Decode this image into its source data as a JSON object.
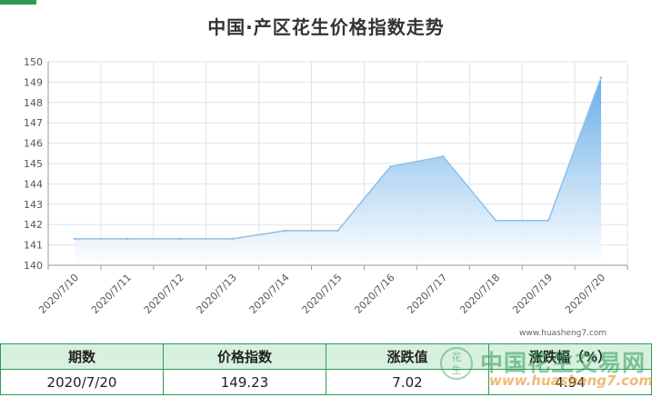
{
  "title": "中国·产区花生价格指数走势",
  "colors": {
    "line": "#8fbfe8",
    "area_top": "#5fa8e8",
    "area_bottom": "#ffffff",
    "grid": "#dde3ea",
    "axis": "#999999",
    "table_border": "#2e9b55",
    "table_header_bg": "#d7f0df"
  },
  "chart_data": {
    "type": "area",
    "title": "中国·产区花生价格指数走势",
    "xlabel": "",
    "ylabel": "",
    "categories": [
      "2020/7/10",
      "2020/7/11",
      "2020/7/12",
      "2020/7/13",
      "2020/7/14",
      "2020/7/15",
      "2020/7/16",
      "2020/7/17",
      "2020/7/18",
      "2020/7/19",
      "2020/7/20"
    ],
    "series": [
      {
        "values": [
          141.3,
          141.3,
          141.3,
          141.3,
          141.7,
          141.7,
          144.85,
          145.35,
          142.2,
          142.2,
          149.23
        ]
      }
    ],
    "ylim": [
      140,
      150
    ],
    "yticks": [
      140,
      141,
      142,
      143,
      144,
      145,
      146,
      147,
      148,
      149,
      150
    ],
    "grid": true,
    "legend": "none"
  },
  "watermark": {
    "url": "www.huasheng7.com",
    "brand_cn": "中国花生交易网",
    "brand_en": "www.huasheng7.com",
    "seal_text": "花生"
  },
  "table": {
    "headers": [
      "期数",
      "价格指数",
      "涨跌值",
      "涨跌幅（%）"
    ],
    "rows": [
      [
        "2020/7/20",
        "149.23",
        "7.02",
        "4.94"
      ]
    ]
  }
}
